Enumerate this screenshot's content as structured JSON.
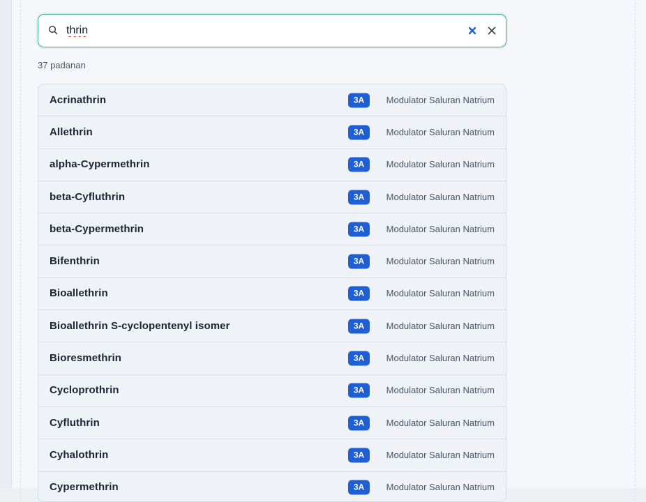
{
  "search": {
    "value": "thrin",
    "placeholder": ""
  },
  "match_count": "37 padanan",
  "colors": {
    "accent_border": "#3fae8b",
    "badge_bg": "#1f5fd6",
    "clear_icon": "#1f5fd6"
  },
  "icons": {
    "search": "search-icon",
    "clear": "clear-icon",
    "close": "close-icon"
  },
  "results": [
    {
      "name": "Acrinathrin",
      "badge": "3A",
      "desc": "Modulator Saluran Natrium"
    },
    {
      "name": "Allethrin",
      "badge": "3A",
      "desc": "Modulator Saluran Natrium"
    },
    {
      "name": "alpha-Cypermethrin",
      "badge": "3A",
      "desc": "Modulator Saluran Natrium"
    },
    {
      "name": "beta-Cyfluthrin",
      "badge": "3A",
      "desc": "Modulator Saluran Natrium"
    },
    {
      "name": "beta-Cypermethrin",
      "badge": "3A",
      "desc": "Modulator Saluran Natrium"
    },
    {
      "name": "Bifenthrin",
      "badge": "3A",
      "desc": "Modulator Saluran Natrium"
    },
    {
      "name": "Bioallethrin",
      "badge": "3A",
      "desc": "Modulator Saluran Natrium"
    },
    {
      "name": "Bioallethrin S-cyclopentenyl isomer",
      "badge": "3A",
      "desc": "Modulator Saluran Natrium"
    },
    {
      "name": "Bioresmethrin",
      "badge": "3A",
      "desc": "Modulator Saluran Natrium"
    },
    {
      "name": "Cycloprothrin",
      "badge": "3A",
      "desc": "Modulator Saluran Natrium"
    },
    {
      "name": "Cyfluthrin",
      "badge": "3A",
      "desc": "Modulator Saluran Natrium"
    },
    {
      "name": "Cyhalothrin",
      "badge": "3A",
      "desc": "Modulator Saluran Natrium"
    },
    {
      "name": "Cypermethrin",
      "badge": "3A",
      "desc": "Modulator Saluran Natrium"
    }
  ]
}
